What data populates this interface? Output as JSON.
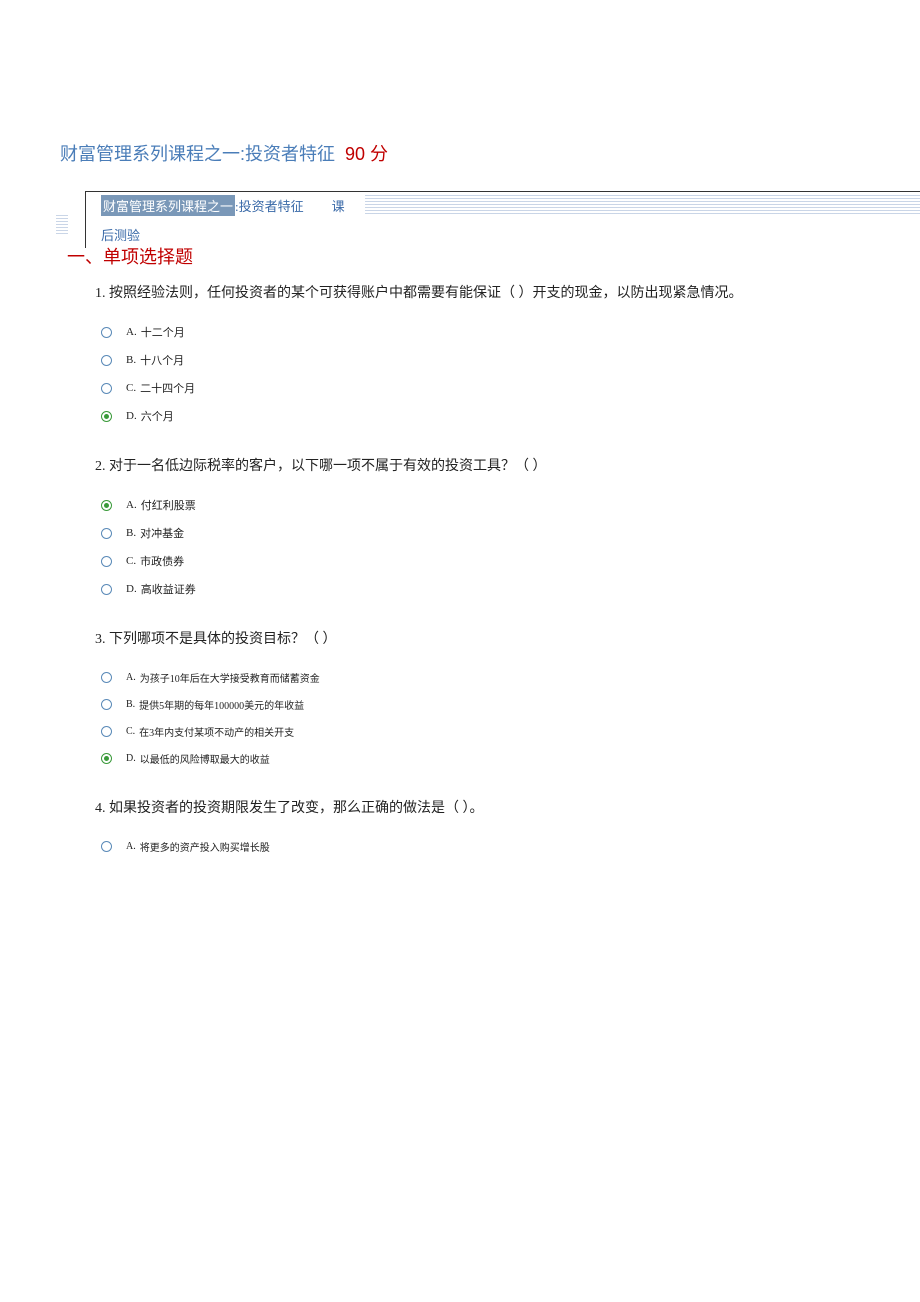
{
  "page_title_prefix": "财富管理系列课程之一:投资者特征",
  "score": "90 分",
  "subtitle": {
    "highlight": "财富管理系列课程之一",
    "link_part": ":投资者特征",
    "suffix": "课",
    "row2": "后测验"
  },
  "section_header": "一、单项选择题",
  "questions": [
    {
      "num": "1.",
      "text": "按照经验法则，任何投资者的某个可获得账户中都需要有能保证（ ）开支的现金，以防出现紧急情况。",
      "options": [
        {
          "label": "A.",
          "text": "十二个月",
          "selected": false
        },
        {
          "label": "B.",
          "text": "十八个月",
          "selected": false
        },
        {
          "label": "C.",
          "text": "二十四个月",
          "selected": false
        },
        {
          "label": "D.",
          "text": "六个月",
          "selected": true
        }
      ],
      "small": false
    },
    {
      "num": "2.",
      "text": "对于一名低边际税率的客户，以下哪一项不属于有效的投资工具？（ ）",
      "options": [
        {
          "label": "A.",
          "text": "付红利股票",
          "selected": true
        },
        {
          "label": "B.",
          "text": "对冲基金",
          "selected": false
        },
        {
          "label": "C.",
          "text": "市政债券",
          "selected": false
        },
        {
          "label": "D.",
          "text": "高收益证券",
          "selected": false
        }
      ],
      "small": false
    },
    {
      "num": "3.",
      "text": "下列哪项不是具体的投资目标？（ ）",
      "options": [
        {
          "label": "A.",
          "text": "为孩子10年后在大学接受教育而储蓄资金",
          "selected": false
        },
        {
          "label": "B.",
          "text": "提供5年期的每年100000美元的年收益",
          "selected": false
        },
        {
          "label": "C.",
          "text": "在3年内支付某项不动产的相关开支",
          "selected": false
        },
        {
          "label": "D.",
          "text": "以最低的风险博取最大的收益",
          "selected": true
        }
      ],
      "small": true
    },
    {
      "num": "4.",
      "text": "如果投资者的投资期限发生了改变，那么正确的做法是（ ）。",
      "options": [
        {
          "label": "A.",
          "text": "将更多的资产投入购买增长股",
          "selected": false
        }
      ],
      "small": true
    }
  ]
}
